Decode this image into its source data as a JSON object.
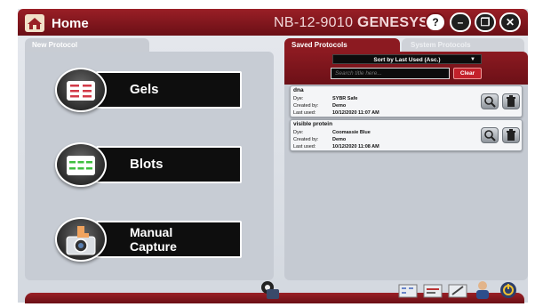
{
  "titlebar": {
    "home_label": "Home",
    "device_model": "NB-12-9010",
    "brand": "ENESYS",
    "brand_initial": "G",
    "buttons": [
      "?",
      "–",
      "❐",
      "✕"
    ]
  },
  "left": {
    "tab_label": "New Protocol",
    "protocols": [
      {
        "label": "Gels",
        "icon": "gels-icon"
      },
      {
        "label": "Blots",
        "icon": "blots-icon"
      },
      {
        "label_line1": "Manual",
        "label_line2": "Capture",
        "icon": "manual-capture-icon"
      }
    ]
  },
  "right": {
    "tabs": {
      "saved": "Saved Protocols",
      "system": "System Protocols"
    },
    "sort_label": "Sort by Last Used (Asc.)",
    "search_placeholder": "Search title here...",
    "clear_label": "Clear",
    "field_labels": {
      "dye": "Dye:",
      "created_by": "Created by:",
      "last_used": "Last used:"
    },
    "cards": [
      {
        "title": "dna",
        "dye": "SYBR Safe",
        "created_by": "Demo",
        "last_used": "10/12/2020 11:07 AM"
      },
      {
        "title": "visible protein",
        "dye": "Coomassie Blue",
        "created_by": "Demo",
        "last_used": "10/12/2020 11:08 AM"
      }
    ]
  },
  "colors": {
    "accent": "#8c1a21",
    "panel": "#c7ccd4"
  },
  "bottom_tools": [
    "settings-tool-icon",
    "gel-image-icon",
    "view-images-icon",
    "edit-images-icon",
    "users-icon",
    "shutdown-icon"
  ]
}
